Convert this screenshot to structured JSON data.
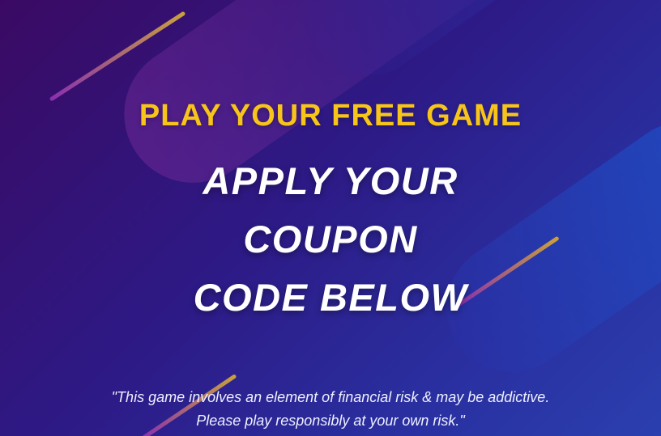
{
  "promo": {
    "subtitle": "PLAY YOUR FREE GAME",
    "title_lines": [
      "APPLY YOUR",
      "COUPON",
      "CODE BELOW"
    ],
    "disclaimer_lines": [
      "\"This game involves an element of financial risk & may be addictive.",
      "Please play responsibly at your own risk.\""
    ]
  },
  "colors": {
    "subtitle": "#f7c51a",
    "title": "#ffffff",
    "background_start": "#3a0a63",
    "background_end": "#2b3fae",
    "streak_start": "#8a2fb0",
    "streak_end": "#c9a23a"
  }
}
